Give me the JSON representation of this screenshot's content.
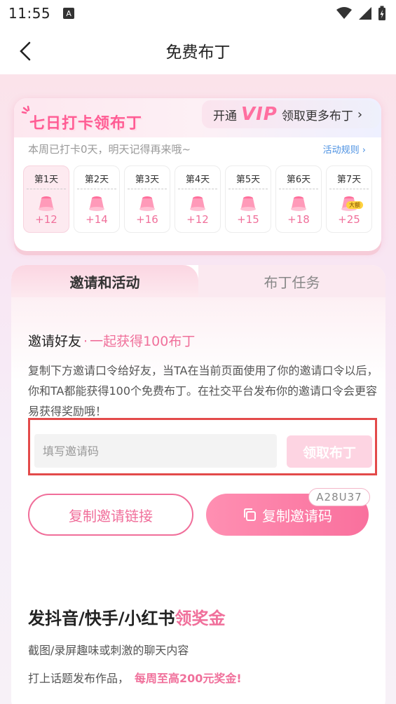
{
  "status_bar": {
    "time": "11:55",
    "a_badge": "A"
  },
  "nav": {
    "title": "免费布丁"
  },
  "checkin": {
    "title": "七日打卡领布丁",
    "vip": {
      "open": "开通",
      "vip": "VIP",
      "more": "领取更多布丁",
      "arrow": "›"
    },
    "subtitle": "本周已打卡0天，明天记得再来哦~",
    "rules": "活动规则 ›",
    "days": [
      {
        "label": "第1天",
        "value": "+12",
        "active": true
      },
      {
        "label": "第2天",
        "value": "+14"
      },
      {
        "label": "第3天",
        "value": "+16"
      },
      {
        "label": "第4天",
        "value": "+12"
      },
      {
        "label": "第5天",
        "value": "+15"
      },
      {
        "label": "第6天",
        "value": "+18"
      },
      {
        "label": "第7天",
        "value": "+25",
        "badge": "大额"
      }
    ]
  },
  "tabs": [
    {
      "label": "邀请和活动",
      "active": true
    },
    {
      "label": "布丁任务",
      "active": false
    }
  ],
  "invite": {
    "title": "邀请好友",
    "dot": "·",
    "highlight": "一起获得100布丁",
    "desc": "复制下方邀请口令给好友，当TA在当前页面使用了你的邀请口令以后，你和TA都能获得100个免费布丁。在社交平台发布你的邀请口令会更容易获得奖励哦！",
    "input_placeholder": "填写邀请码",
    "claim_button": "领取布丁",
    "copy_link_button": "复制邀请链接",
    "copy_code_button": "复制邀请码",
    "code": "A28U37"
  },
  "section2": {
    "title": "发抖音/快手/小红书",
    "title_highlight": "领奖金",
    "line1": "截图/录屏趣味或刺激的聊天内容",
    "line2": "打上话题发布作品，",
    "line2_highlight": "每周至高200元奖金!"
  },
  "colors": {
    "accent": "#f0709b",
    "highlight_border": "#e34a4a"
  }
}
